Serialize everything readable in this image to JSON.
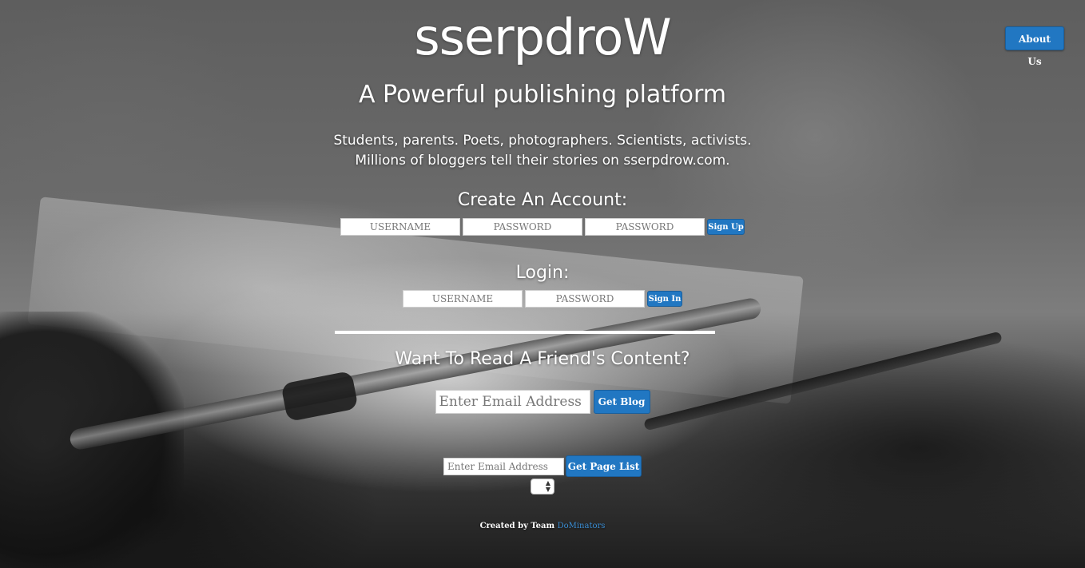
{
  "brand": {
    "title": "sserpdroW"
  },
  "nav": {
    "about_label": "About Us"
  },
  "hero": {
    "tagline": "A Powerful publishing platform",
    "blurb_line1": "Students, parents. Poets, photographers. Scientists, activists.",
    "blurb_line2": "Millions of bloggers tell their stories on sserpdrow.com."
  },
  "signup": {
    "heading": "Create An Account:",
    "username_placeholder": "USERNAME",
    "password_placeholder": "PASSWORD",
    "confirm_placeholder": "PASSWORD",
    "button_label": "Sign Up"
  },
  "login": {
    "heading": "Login:",
    "username_placeholder": "USERNAME",
    "password_placeholder": "PASSWORD",
    "button_label": "Sign In"
  },
  "friend": {
    "heading": "Want To Read A Friend's Content?",
    "email_placeholder": "Enter Email Address",
    "button_label": "Get Blog"
  },
  "pagelist": {
    "email_placeholder": "Enter Email Address",
    "button_label": "Get Page List",
    "select_value": ""
  },
  "footer": {
    "prefix": "Created by Team",
    "team_link": "DoMinators"
  },
  "colors": {
    "accent": "#2177c2",
    "link": "#3b8fd6"
  }
}
